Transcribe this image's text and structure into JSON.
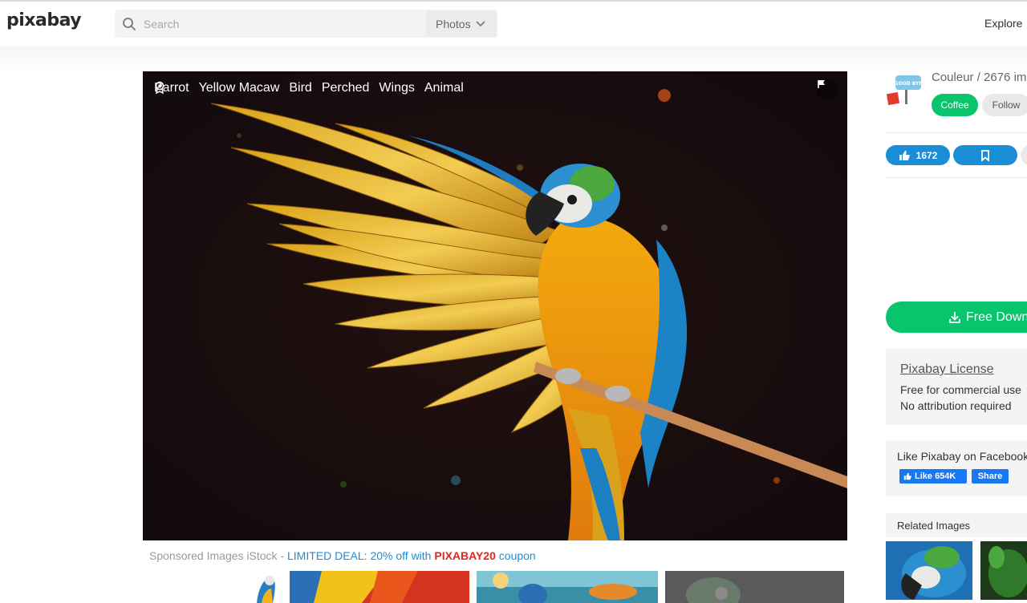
{
  "header": {
    "logo": "pixabay",
    "search_placeholder": "Search",
    "media_type": "Photos",
    "explore": "Explore"
  },
  "photo": {
    "tags": [
      "Parrot",
      "Yellow Macaw",
      "Bird",
      "Perched",
      "Wings",
      "Animal"
    ]
  },
  "sponsored": {
    "prefix": "Sponsored Images iStock - ",
    "deal": "LIMITED DEAL: 20% off with ",
    "code": "PIXABAY20",
    "suffix": " coupon"
  },
  "sidebar": {
    "username": "Couleur / 2676 im",
    "coffee": "Coffee",
    "follow": "Follow",
    "likes": "1672",
    "download": "Free Down",
    "license": {
      "title": "Pixabay License",
      "line1": "Free for commercial use",
      "line2": "No attribution required"
    },
    "facebook": {
      "title": "Like Pixabay on Facebook",
      "like": "Like 654K",
      "share": "Share"
    },
    "related": "Related Images"
  },
  "colors": {
    "accent_green": "#0ac46c",
    "accent_blue": "#1a8ed6",
    "coupon_red": "#e2271a"
  }
}
